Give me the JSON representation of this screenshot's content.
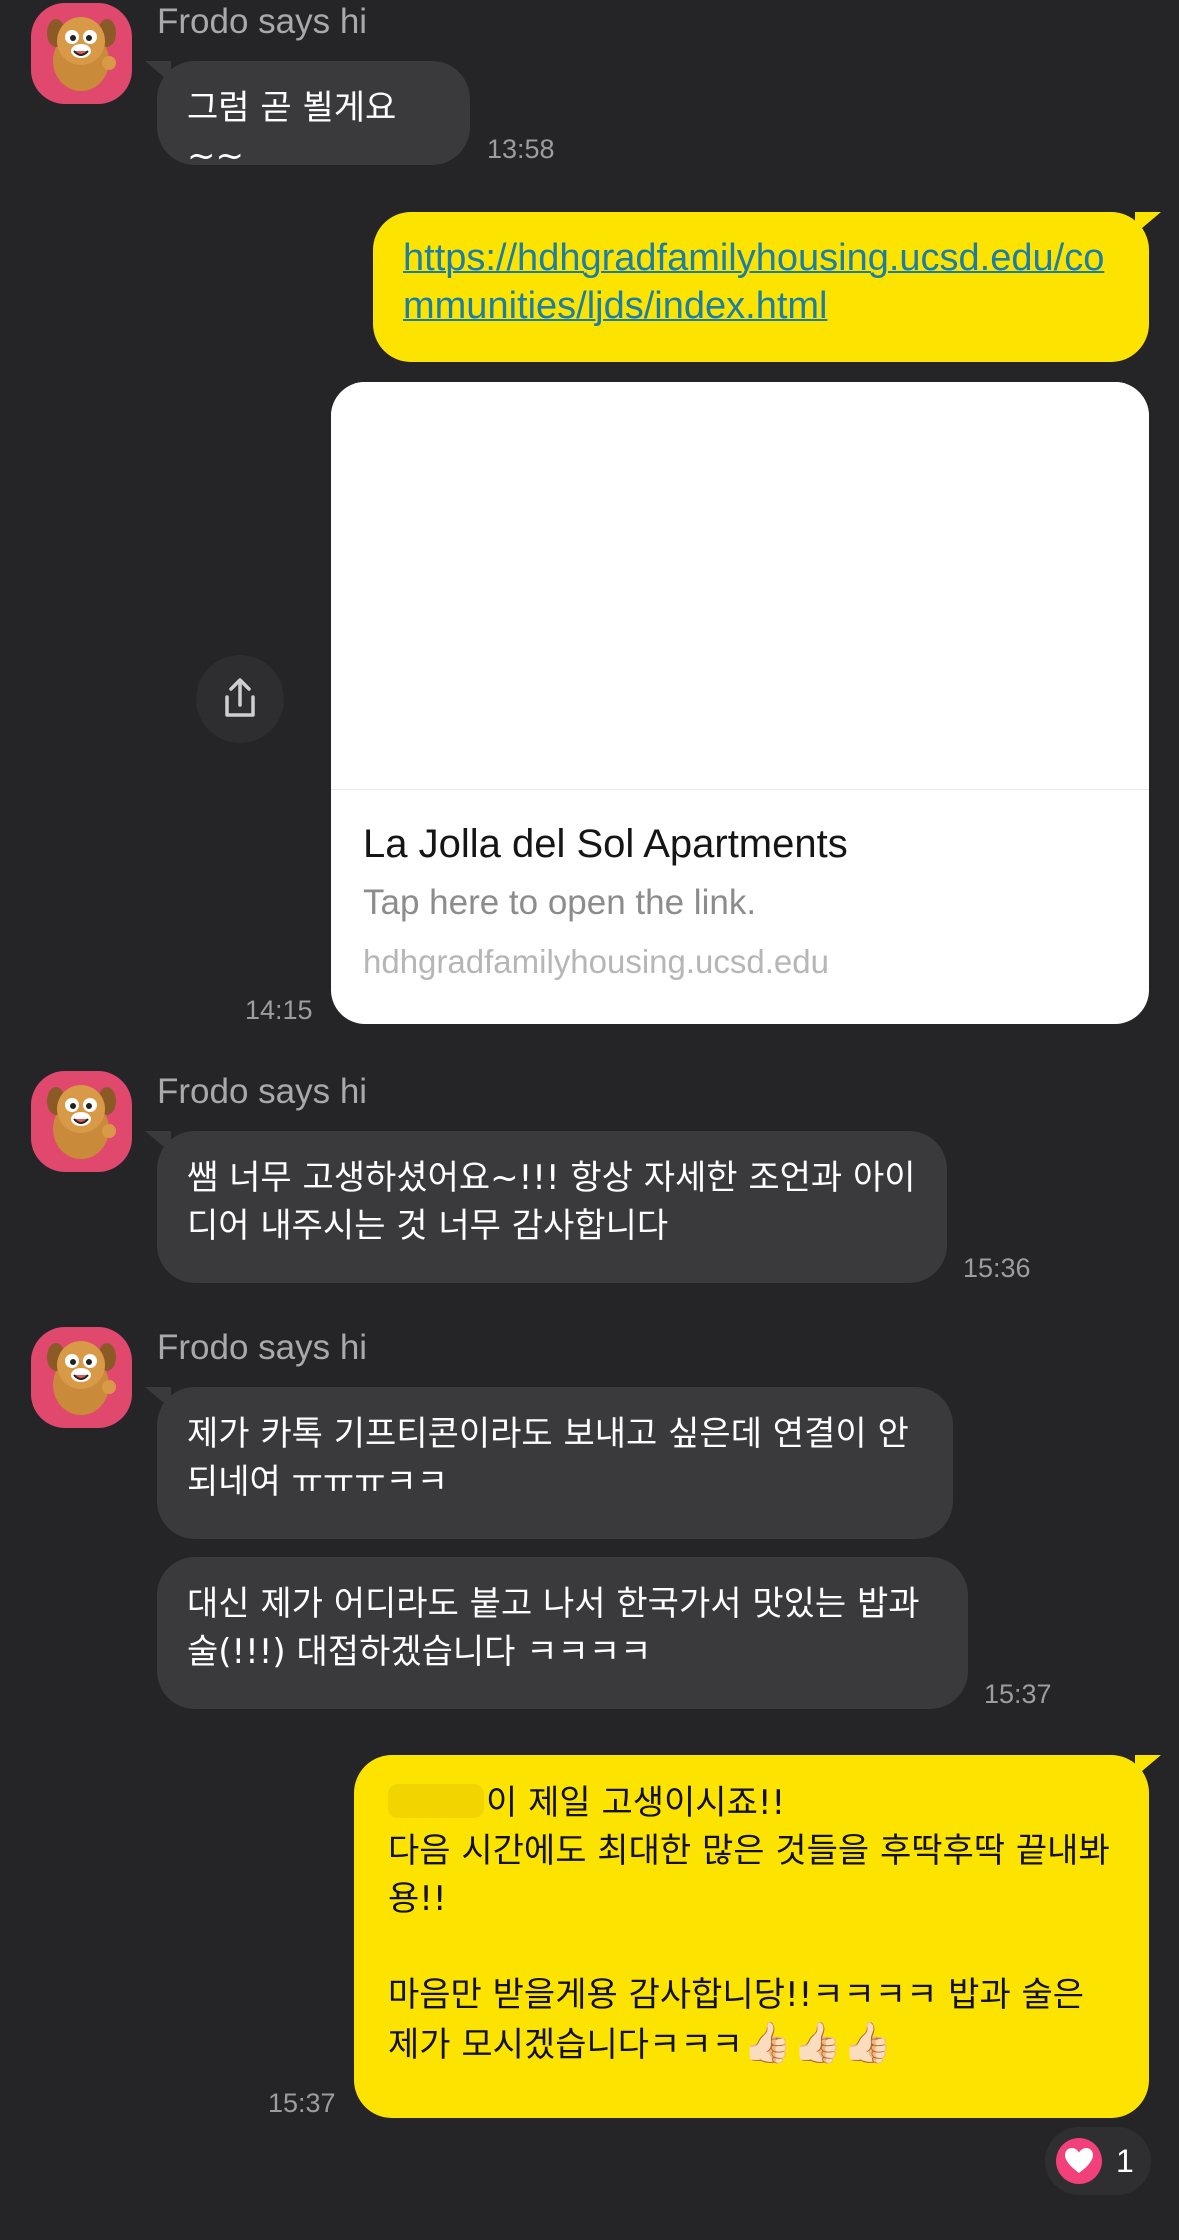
{
  "theme": {
    "background": "#252527",
    "incoming_bubble": "#3a3a3c",
    "outgoing_bubble": "#fde400",
    "link_color": "#1d7ea3",
    "reaction_heart": "#f2407a"
  },
  "contact": {
    "name": "Frodo says hi",
    "avatar_icon": "brown-dog-character-avatar"
  },
  "messages": [
    {
      "sender": "Frodo says hi",
      "text": "그럼 곧 뵐게요~~",
      "time": "13:58"
    },
    {
      "outgoing_link": "https://hdhgradfamilyhousing.ucsd.edu/communities/ljds/index.html",
      "card": {
        "title": "La Jolla del Sol Apartments",
        "description": "Tap here to open the link.",
        "domain": "hdhgradfamilyhousing.ucsd.edu"
      },
      "time": "14:15",
      "share_icon": "share-icon"
    },
    {
      "sender": "Frodo says hi",
      "text": "쌤 너무 고생하셨어요~!!! 항상 자세한 조언과 아이디어 내주시는 것 너무 감사합니다",
      "time": "15:36"
    },
    {
      "sender": "Frodo says hi",
      "text": "제가 카톡 기프티콘이라도 보내고 싶은데 연결이 안되네여 ㅠㅠㅠㅋㅋ"
    },
    {
      "text": "대신 제가 어디라도 붙고 나서 한국가서 맛있는 밥과 술(!!!) 대접하겠습니다 ㅋㅋㅋㅋ",
      "time": "15:37"
    },
    {
      "outgoing": true,
      "line1": "이 제일 고생이시죠!!",
      "line2": "다음 시간에도 최대한 많은 것들을 후딱후딱 끝내봐용!!",
      "line3": "마음만 받을게용 감사합니당!!ㅋㅋㅋㅋ 밥과 술은 제가 모시겠습니다ㅋㅋㅋ",
      "emoji": "👍🏻👍🏻👍🏻",
      "time": "15:37"
    }
  ],
  "reaction": {
    "icon": "heart-icon",
    "count": "1"
  }
}
